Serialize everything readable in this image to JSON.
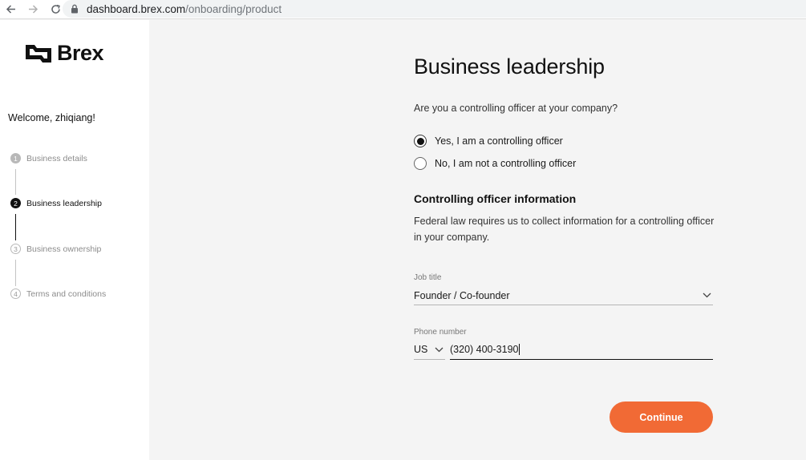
{
  "browser": {
    "url_host": "dashboard.brex.com",
    "url_path": "/onboarding/product"
  },
  "sidebar": {
    "logo_text": "Brex",
    "welcome": "Welcome, zhiqiang!",
    "steps": [
      {
        "number": "1",
        "label": "Business details",
        "state": "done"
      },
      {
        "number": "2",
        "label": "Business leadership",
        "state": "current"
      },
      {
        "number": "3",
        "label": "Business ownership",
        "state": "todo"
      },
      {
        "number": "4",
        "label": "Terms and conditions",
        "state": "todo"
      }
    ]
  },
  "main": {
    "title": "Business leadership",
    "question": "Are you a controlling officer at your company?",
    "options": [
      {
        "label": "Yes, I am a controlling officer",
        "selected": true
      },
      {
        "label": "No, I am not a controlling officer",
        "selected": false
      }
    ],
    "section_title": "Controlling officer information",
    "section_desc": "Federal law requires us to collect information for a controlling officer in your company.",
    "job_title": {
      "label": "Job title",
      "value": "Founder / Co-founder"
    },
    "phone": {
      "label": "Phone number",
      "country": "US",
      "value": "(320) 400-3190"
    },
    "continue_label": "Continue"
  },
  "colors": {
    "accent": "#f16a35",
    "sidebar_bg": "#ffffff",
    "main_bg": "#f4f4f4"
  }
}
